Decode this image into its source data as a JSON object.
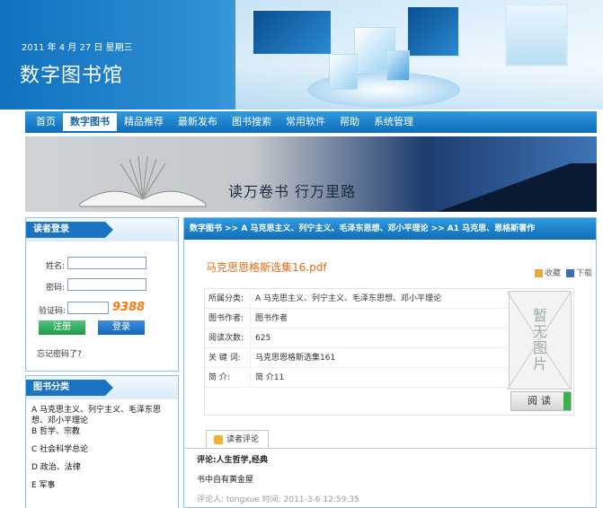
{
  "header": {
    "date": "2011 年 4 月 27 日 星期三",
    "site_title": "数字图书馆"
  },
  "nav": {
    "items": [
      "首页",
      "数字图书",
      "精品推荐",
      "最新发布",
      "图书搜索",
      "常用软件",
      "帮助",
      "系统管理"
    ],
    "active": "数字图书"
  },
  "banner": {
    "slogan": "读万卷书  行万里路"
  },
  "login": {
    "title": "读者登录",
    "name_label": "姓名:",
    "password_label": "密码:",
    "captcha_label": "验证码:",
    "captcha_value": "9388",
    "register_label": "注册",
    "login_label": "登录",
    "forgot_label": "忘记密码了?"
  },
  "category": {
    "title": "图书分类",
    "items": [
      "A 马克思主义、列宁主义、毛泽东思想、邓小平理论",
      "B 哲学、宗教",
      "C 社会科学总论",
      "D 政治、法律",
      "E 军事"
    ]
  },
  "main": {
    "breadcrumb": "数字图书 >> A 马克思主义、列宁主义、毛泽东思想、邓小平理论 >> A1 马克思、恩格斯著作",
    "book_title": "马克思恩格斯选集16.pdf",
    "collect_label": "收藏",
    "download_label": "下载",
    "info": [
      {
        "label": "所属分类:",
        "value": "A 马克思主义、列宁主义、毛泽东思想、邓小平理论"
      },
      {
        "label": "图书作者:",
        "value": "图书作者"
      },
      {
        "label": "阅读次数:",
        "value": "625"
      },
      {
        "label": "关 键 词:",
        "value": "马克思恩格斯选集161"
      },
      {
        "label": "简      介:",
        "value": "简      介11"
      }
    ],
    "no_image_text": "暂无图片",
    "read_label": "阅读",
    "comment_tab": "读者评论",
    "comment_title": "评论:人生哲学,经典",
    "comment_body": "书中自有黄金屋",
    "comment_meta": "评论人: tongxue    时间: 2011-3-6 12:59:35"
  },
  "colors": {
    "nav_blue": "#1a74c2",
    "title_orange": "#e06a10",
    "captcha_orange": "#f47a16",
    "register_green": "#219a4d"
  }
}
